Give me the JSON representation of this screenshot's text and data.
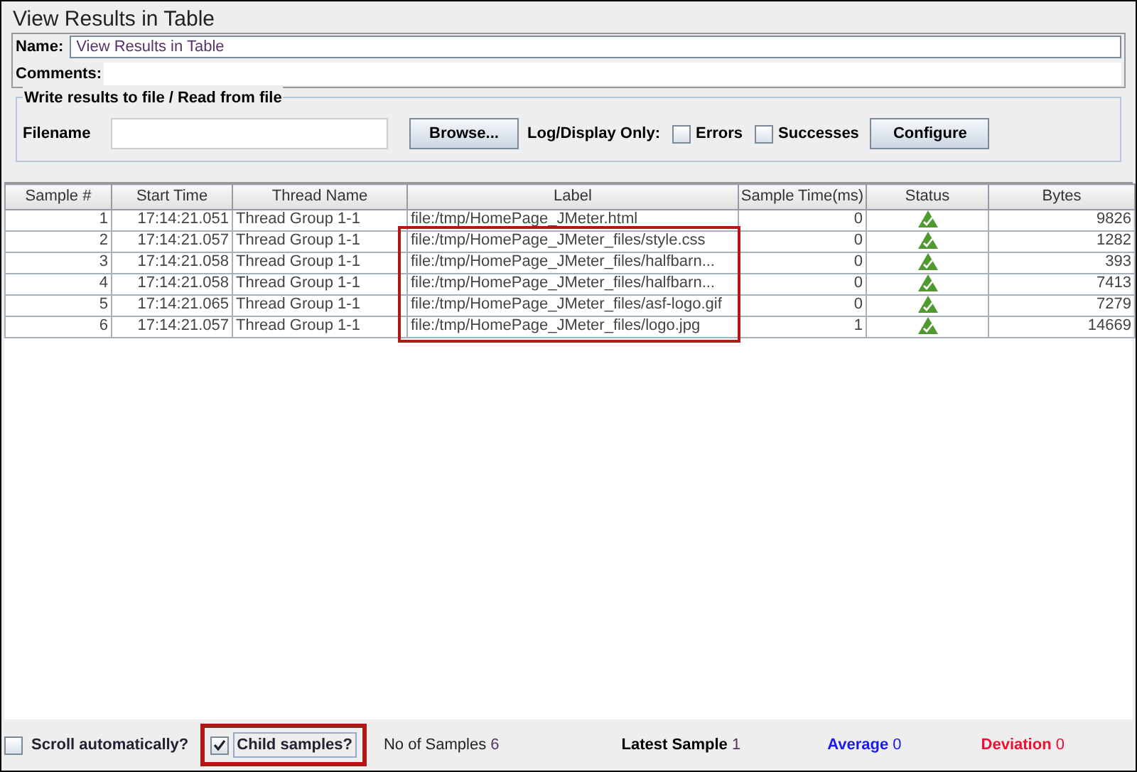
{
  "window": {
    "title": "View Results in Table"
  },
  "name": {
    "label": "Name:",
    "value": "View Results in Table"
  },
  "comments": {
    "label": "Comments:"
  },
  "file_group": {
    "title": "Write results to file / Read from file",
    "filename_label": "Filename",
    "browse_button": "Browse...",
    "log_display_label": "Log/Display Only:",
    "checkboxes": [
      {
        "label": "Errors",
        "checked": false
      },
      {
        "label": "Successes",
        "checked": false
      }
    ],
    "configure_button": "Configure"
  },
  "table": {
    "columns": [
      "Sample #",
      "Start Time",
      "Thread Name",
      "Label",
      "Sample Time(ms)",
      "Status",
      "Bytes"
    ],
    "rows": [
      {
        "sample": "1",
        "start": "17:14:21.051",
        "thread": "Thread Group 1-1",
        "label": "file:/tmp/HomePage_JMeter.html",
        "time": "0",
        "success": true,
        "bytes": "9826"
      },
      {
        "sample": "2",
        "start": "17:14:21.057",
        "thread": "Thread Group 1-1",
        "label": "file:/tmp/HomePage_JMeter_files/style.css",
        "time": "0",
        "success": true,
        "bytes": "1282"
      },
      {
        "sample": "3",
        "start": "17:14:21.058",
        "thread": "Thread Group 1-1",
        "label": "file:/tmp/HomePage_JMeter_files/halfbarn...",
        "time": "0",
        "success": true,
        "bytes": "393"
      },
      {
        "sample": "4",
        "start": "17:14:21.058",
        "thread": "Thread Group 1-1",
        "label": "file:/tmp/HomePage_JMeter_files/halfbarn...",
        "time": "0",
        "success": true,
        "bytes": "7413"
      },
      {
        "sample": "5",
        "start": "17:14:21.065",
        "thread": "Thread Group 1-1",
        "label": "file:/tmp/HomePage_JMeter_files/asf-logo.gif",
        "time": "0",
        "success": true,
        "bytes": "7279"
      },
      {
        "sample": "6",
        "start": "17:14:21.057",
        "thread": "Thread Group 1-1",
        "label": "file:/tmp/HomePage_JMeter_files/logo.jpg",
        "time": "1",
        "success": true,
        "bytes": "14669"
      }
    ]
  },
  "footer": {
    "scroll": {
      "label": "Scroll automatically?",
      "checked": false
    },
    "child": {
      "label": "Child samples?",
      "checked": true
    },
    "samples_label": "No of Samples",
    "samples_value": "6",
    "latest_label": "Latest Sample",
    "latest_value": "1",
    "average_label": "Average",
    "average_value": "0",
    "deviation_label": "Deviation",
    "deviation_value": "0"
  }
}
